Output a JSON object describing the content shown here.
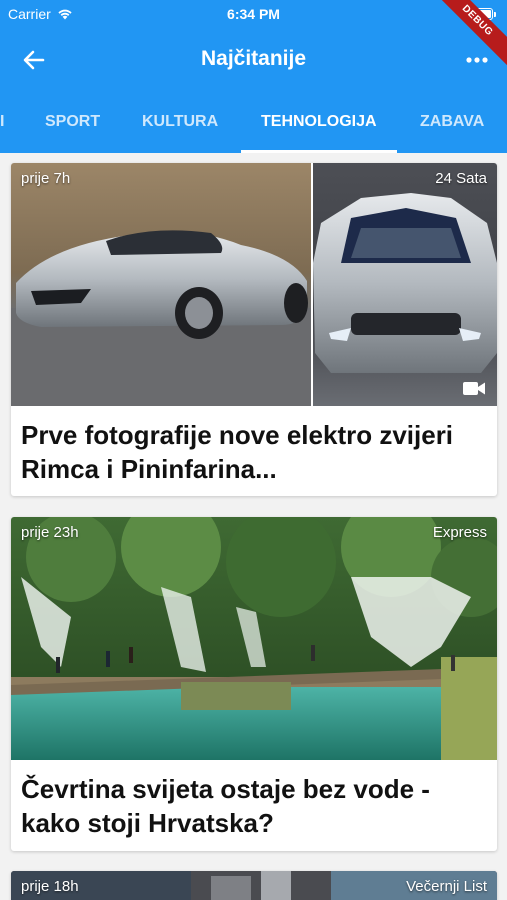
{
  "status_bar": {
    "carrier": "Carrier",
    "time": "6:34 PM"
  },
  "toolbar": {
    "title": "Najčitanije",
    "back_icon": "arrow-left-icon",
    "more_icon": "more-horiz-icon"
  },
  "debug_banner": "DEBUG",
  "tabs": [
    {
      "label": "I"
    },
    {
      "label": "SPORT"
    },
    {
      "label": "KULTURA"
    },
    {
      "label": "TEHNOLOGIJA",
      "active": true
    },
    {
      "label": "ZABAVA"
    }
  ],
  "articles": [
    {
      "age": "prije 7h",
      "source": "24 Sata",
      "headline": "Prve fotografije nove elektro zvijeri Rimca i Pininfarina...",
      "has_video": true
    },
    {
      "age": "prije 23h",
      "source": "Express",
      "headline": "Čevrtina svijeta ostaje bez vode - kako stoji Hrvatska?",
      "has_video": false
    },
    {
      "age": "prije 18h",
      "source": "Večernji List",
      "headline": "",
      "has_video": false
    }
  ],
  "colors": {
    "primary": "#2196f3",
    "debug": "#b71c1c",
    "card": "#ffffff",
    "background": "#f2f2f2"
  }
}
